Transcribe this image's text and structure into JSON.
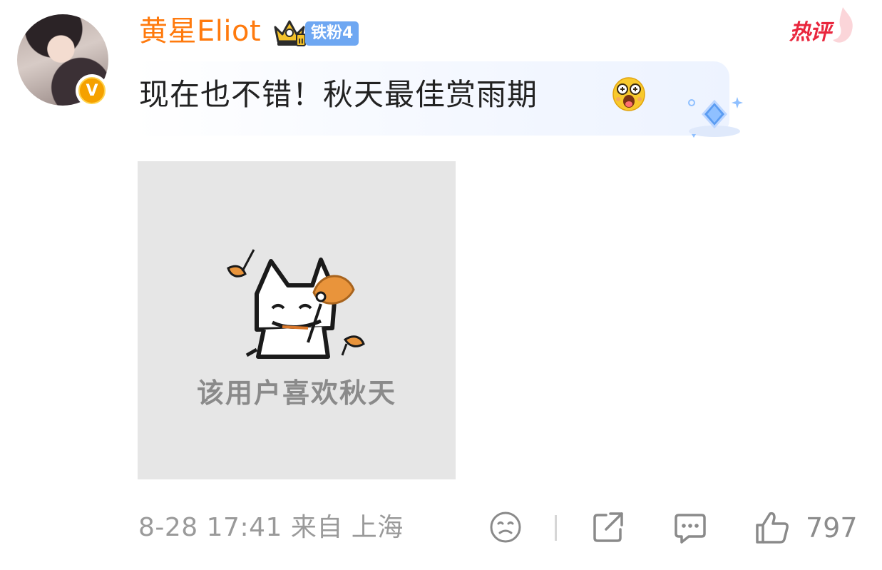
{
  "user": {
    "name": "黄星Eliot",
    "verified_badge": "V",
    "fan_badge": "铁粉4",
    "crown_icon": "crown-icon"
  },
  "hot_badge": "热评",
  "comment": {
    "text": "现在也不错！秋天最佳赏雨期",
    "emoji": "amazed-face-emoji"
  },
  "image": {
    "caption": "该用户喜欢秋天",
    "description_icon": "cat-with-leaves-sticker"
  },
  "footer": {
    "meta": "8-28 17:41 来自 上海",
    "like_count": "797",
    "icons": [
      "sad-face-icon",
      "share-icon",
      "comment-icon",
      "like-icon"
    ]
  },
  "colors": {
    "username": "#ff7a0d",
    "fan_badge": "#6ea7f2",
    "hot_badge": "#e9263d",
    "meta": "#9a9a9a"
  }
}
